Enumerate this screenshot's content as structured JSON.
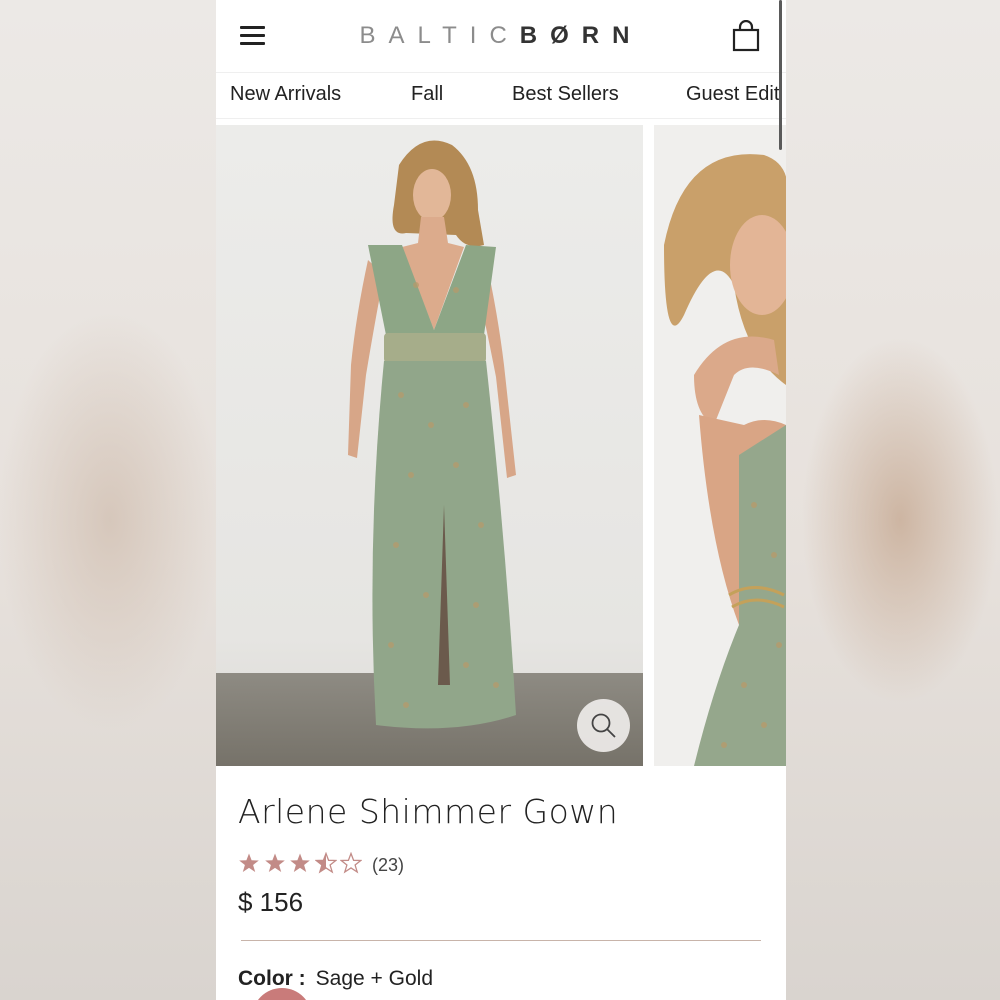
{
  "header": {
    "brand_light": "BALTIC",
    "brand_dark": "BØRN",
    "menu_icon": "hamburger-menu-icon",
    "bag_icon": "shopping-bag-icon"
  },
  "nav": {
    "items": [
      "New Arrivals",
      "Fall",
      "Best Sellers",
      "Guest Edit"
    ]
  },
  "gallery": {
    "zoom_icon": "magnifier-icon"
  },
  "product": {
    "title": "Arlene Shimmer Gown",
    "rating": 3.5,
    "rating_max": 5,
    "review_count": "(23)",
    "price": "$ 156",
    "color_label": "Color :",
    "color_value": "Sage + Gold"
  },
  "colors": {
    "star": "#c28b87",
    "accent_swatch": "#c97b7a",
    "divider": "#c8b4aa"
  }
}
